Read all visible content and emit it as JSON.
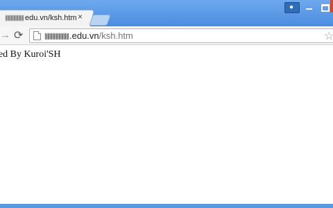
{
  "browser": {
    "tab": {
      "title_visible": "edu.vn/ksh.htm",
      "close_glyph": "×"
    },
    "toolbar": {
      "forward_icon": "→",
      "reload_icon": "⟳",
      "url_host_visible": ".edu.vn",
      "url_path": "/ksh.htm",
      "bookmark_icon": "☆"
    },
    "window_controls": {
      "profile_icon": "👤"
    }
  },
  "page": {
    "text": "ted By Kuroi'SH"
  },
  "colors": {
    "frame": "#4f8fdc",
    "tab_bg": "#f3f3f3",
    "toolbar_bg": "#f6f6f6",
    "page_bg": "#ffffff",
    "close_red": "#c44b3c"
  }
}
